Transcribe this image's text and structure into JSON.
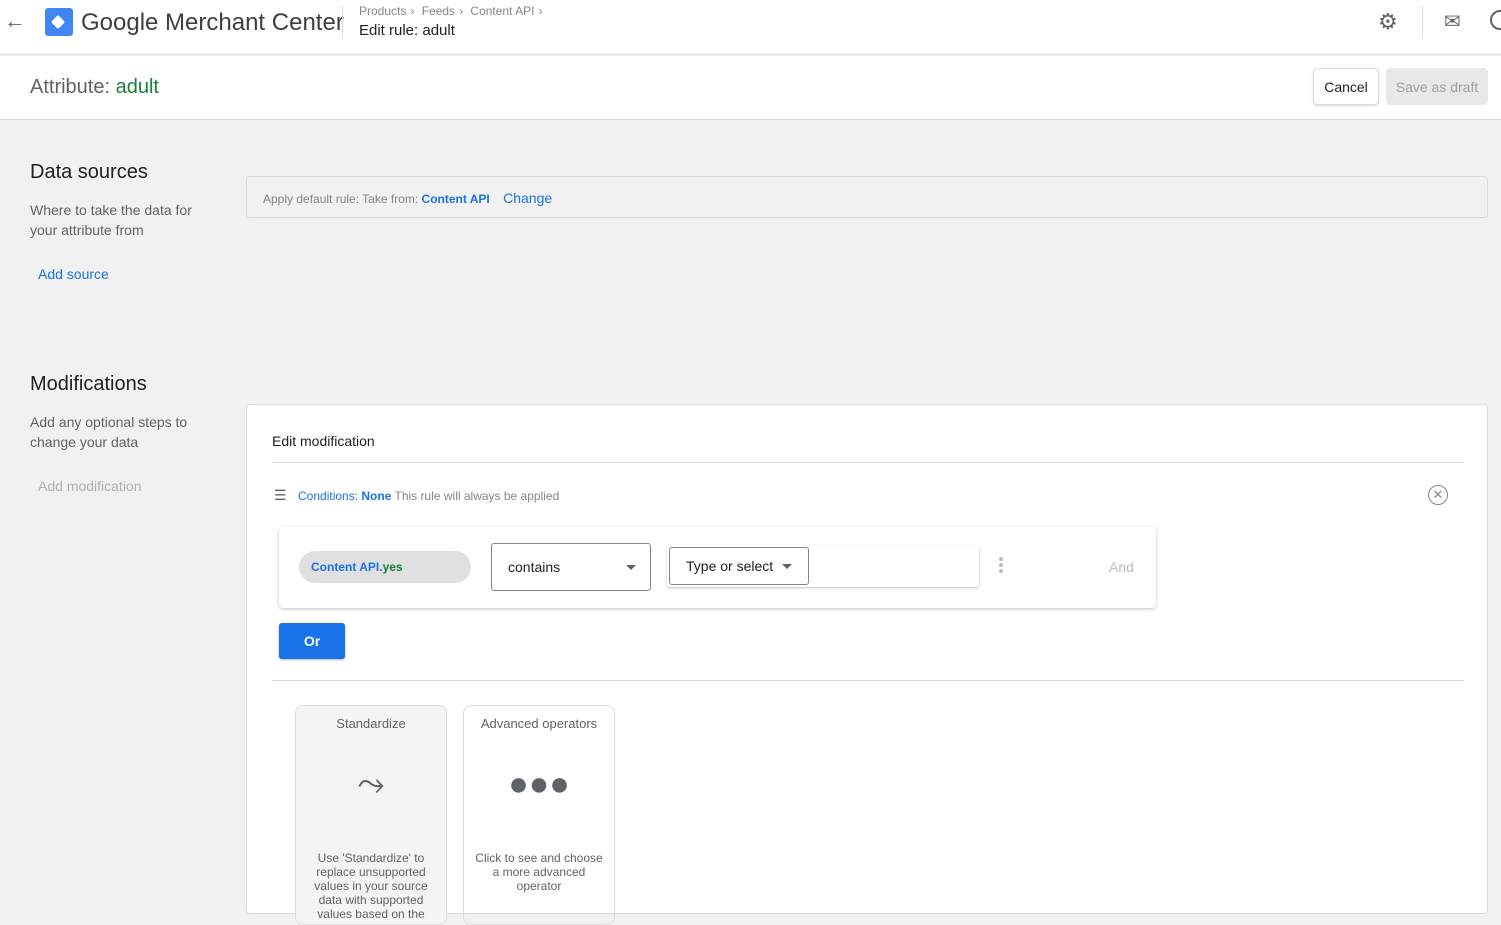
{
  "header": {
    "brand": "Google Merchant Center",
    "breadcrumbs": [
      "Products",
      "Feeds",
      "Content API"
    ],
    "title": "Edit rule: adult"
  },
  "attribute": {
    "label": "Attribute:",
    "name": "adult",
    "cancel": "Cancel",
    "save_draft": "Save as draft"
  },
  "data_sources": {
    "heading": "Data sources",
    "description": "Where to take the data for your attribute from",
    "add_source": "Add source",
    "default_rule": "Apply default rule: Take from:",
    "source": "Content API",
    "change": "Change"
  },
  "modifications": {
    "heading": "Modifications",
    "description": "Add any optional steps to change your data",
    "add_modification": "Add modification"
  },
  "edit": {
    "title": "Edit modification",
    "conditions_label": "Conditions:",
    "conditions_value": "None",
    "conditions_note": "This rule will always be applied",
    "chip_source": "Content API.",
    "chip_value": "yes",
    "operator": "contains",
    "value_placeholder": "Type or select",
    "and": "And",
    "or": "Or"
  },
  "operators": [
    {
      "title": "Standardize",
      "description": "Use 'Standardize' to replace unsupported values in your source data with supported values based on the"
    },
    {
      "title": "Advanced operators",
      "description": "Click to see and choose a more advanced operator"
    }
  ]
}
